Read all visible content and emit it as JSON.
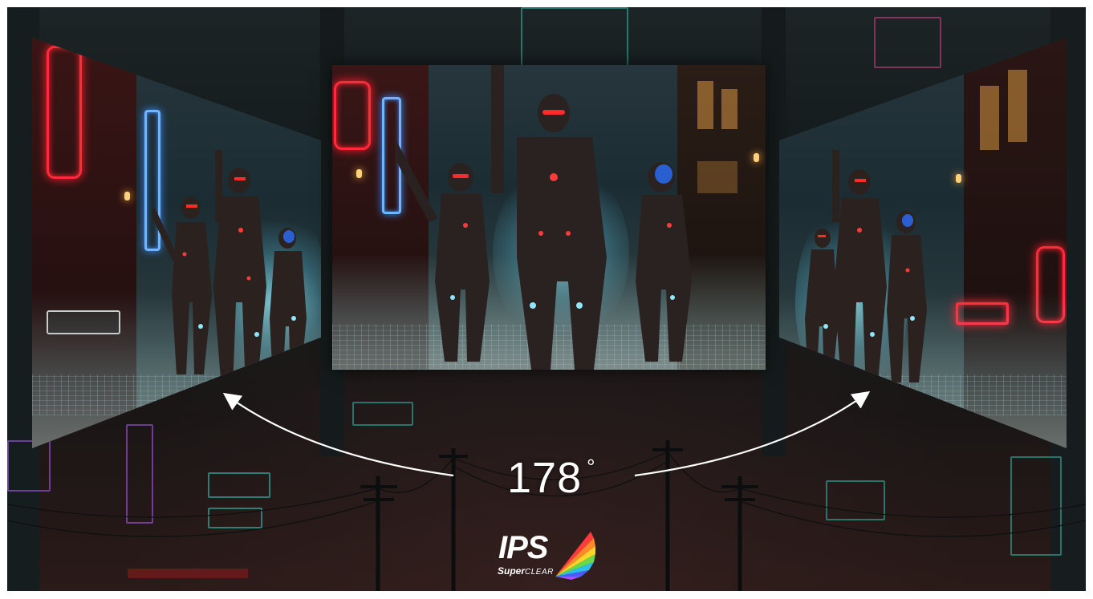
{
  "viewing_angle": {
    "value": "178",
    "unit": "°"
  },
  "logo": {
    "name": "ips-superclear-logo",
    "main_text": "IPS",
    "sub_bold": "Super",
    "sub_light": "CLEAR"
  },
  "screens": [
    {
      "name": "screen-left",
      "view": "angled-left"
    },
    {
      "name": "screen-center",
      "view": "front"
    },
    {
      "name": "screen-right",
      "view": "angled-right"
    }
  ],
  "colors": {
    "neon_red": "#ff2a3a",
    "neon_blue": "#6fb6ff",
    "visor_red": "#ff2a2a",
    "ambient_cyan": "#9fe8ff",
    "text": "#ffffff"
  }
}
